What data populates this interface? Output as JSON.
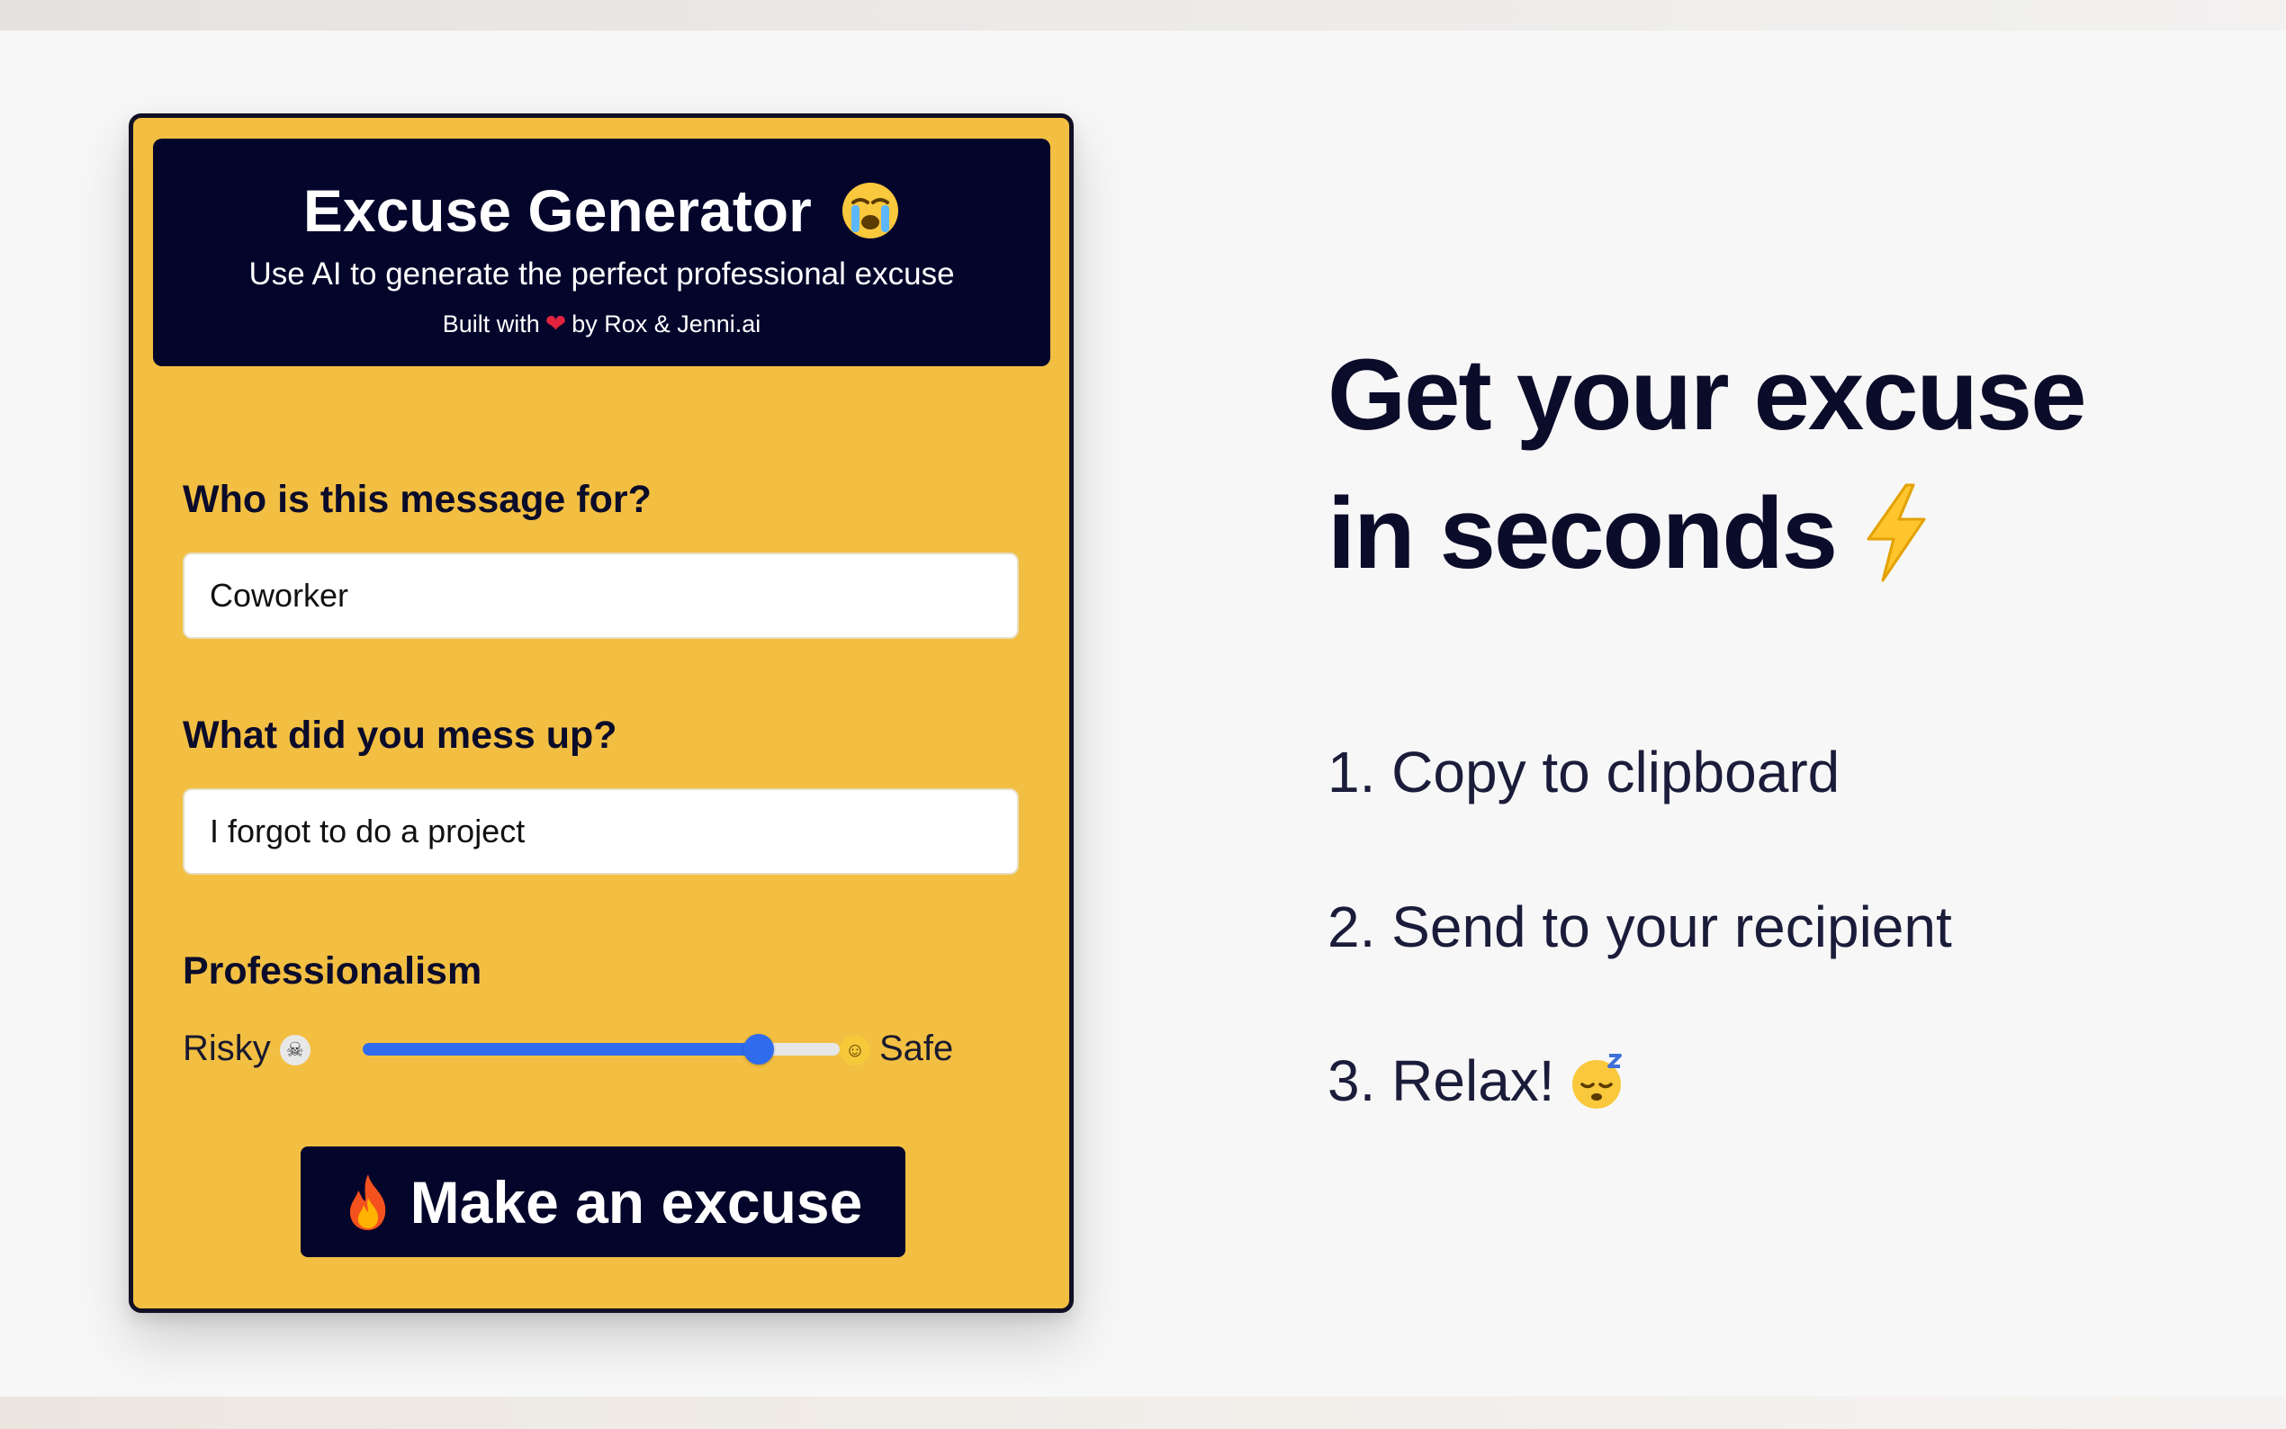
{
  "card": {
    "title": "Excuse Generator",
    "title_icon": "loudly-crying-face-emoji",
    "subtitle": "Use AI to generate the perfect professional excuse",
    "credit_prefix": "Built with",
    "credit_icon": "red-heart-emoji",
    "credit_suffix": "by Rox & Jenni.ai"
  },
  "form": {
    "recipient_label": "Who is this message for?",
    "recipient_value": "Coworker",
    "mistake_label": "What did you mess up?",
    "mistake_value": "I forgot to do a project",
    "professionalism_label": "Professionalism",
    "slider_min_label": "Risky",
    "slider_min_icon": "skull-emoji",
    "slider_max_label": "Safe",
    "slider_max_icon": "nerd-face-emoji",
    "slider_value_fraction": 0.83,
    "submit_label": "Make an excuse",
    "submit_icon": "fire-emoji"
  },
  "promo": {
    "headline_line1": "Get your excuse",
    "headline_line2": "in seconds",
    "headline_icon": "lightning-bolt-emoji",
    "steps": [
      "1. Copy to clipboard",
      "2. Send to your recipient",
      "3. Relax!"
    ],
    "step3_icon": "sleeping-face-emoji"
  },
  "colors": {
    "page_background": "#f7f7f7",
    "card_background": "#f2bf42",
    "navy": "#04052b",
    "slider_accent": "#2f6bed"
  }
}
